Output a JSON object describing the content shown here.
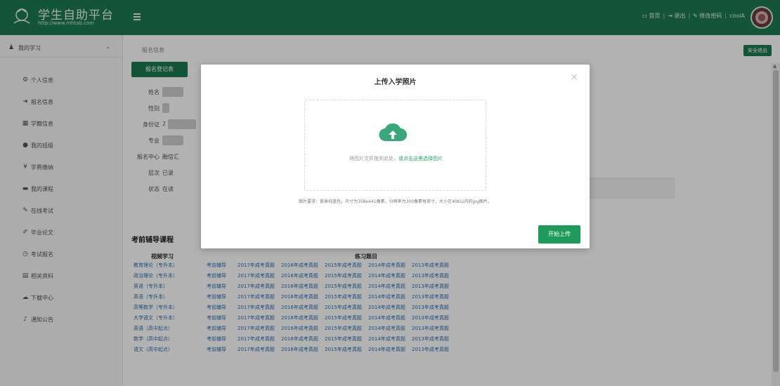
{
  "header": {
    "title": "学生自助平台",
    "subtitle": "http://www.mhtab.com",
    "links": [
      {
        "icon": "monitor-icon",
        "label": "首页"
      },
      {
        "icon": "logout-icon",
        "label": "退出"
      },
      {
        "icon": "pencil-icon",
        "label": "修改密码"
      },
      {
        "icon": "user-icon",
        "label": "coolA"
      }
    ]
  },
  "sidebar": {
    "section": "我的学习",
    "items": [
      {
        "icon": "gear-icon",
        "label": "个人信息"
      },
      {
        "icon": "arrow-icon",
        "label": "报名信息"
      },
      {
        "icon": "grid-icon",
        "label": "学籍信息"
      },
      {
        "icon": "dot-icon",
        "label": "我的班级"
      },
      {
        "icon": "book-icon",
        "label": "学费缴纳"
      },
      {
        "icon": "list-icon",
        "label": "我的课程"
      },
      {
        "icon": "pencil-icon",
        "label": "在线考试"
      },
      {
        "icon": "edit-icon",
        "label": "毕业论文"
      },
      {
        "icon": "clock-icon",
        "label": "考试报名"
      },
      {
        "icon": "table-icon",
        "label": "相关资料"
      },
      {
        "icon": "cloud-icon",
        "label": "下载中心"
      },
      {
        "icon": "bell-icon",
        "label": "通知公告"
      }
    ]
  },
  "main": {
    "breadcrumb": "报名信息",
    "logout_button": "安全退出",
    "action_button": "报名登记表",
    "info": [
      {
        "label": "姓名",
        "value": ""
      },
      {
        "label": "性别",
        "value": ""
      },
      {
        "label": "身份证",
        "value": "2"
      },
      {
        "label": "专业",
        "value": ""
      },
      {
        "label": "报名中心",
        "value": "融信汇"
      },
      {
        "label": "层次",
        "value": "已录"
      },
      {
        "label": "状态",
        "value": "在读"
      }
    ],
    "section_title": "考前辅导课程",
    "col_headers": [
      "视频学习",
      "练习题目"
    ],
    "rows": [
      [
        "教育理论（专升本）",
        "考前辅导",
        "2017年成考真题",
        "2016年成考真题",
        "2015年成考真题",
        "2014年成考真题",
        "2013年成考真题"
      ],
      [
        "政治理论（专升本）",
        "考前辅导",
        "2017年成考真题",
        "2016年成考真题",
        "2015年成考真题",
        "2014年成考真题",
        "2013年成考真题"
      ],
      [
        "英语（专升本）",
        "考前辅导",
        "2017年成考真题",
        "2016年成考真题",
        "2015年成考真题",
        "2014年成考真题",
        "2013年成考真题"
      ],
      [
        "英语（专升本）",
        "考前辅导",
        "2017年成考真题",
        "2016年成考真题",
        "2015年成考真题",
        "2014年成考真题",
        "2013年成考真题"
      ],
      [
        "高等数学（专升本）",
        "考前辅导",
        "2017年成考真题",
        "2016年成考真题",
        "2015年成考真题",
        "2014年成考真题",
        "2013年成考真题"
      ],
      [
        "大学语文（专升本）",
        "考前辅导",
        "2017年成考真题",
        "2016年成考真题",
        "2015年成考真题",
        "2014年成考真题",
        "2013年成考真题"
      ],
      [
        "英语（高中起点）",
        "考前辅导",
        "2017年成考真题",
        "2016年成考真题",
        "2015年成考真题",
        "2014年成考真题",
        "2013年成考真题"
      ],
      [
        "数学（高中起点）",
        "考前辅导",
        "2017年成考真题",
        "2016年成考真题",
        "2015年成考真题",
        "2014年成考真题",
        "2013年成考真题"
      ],
      [
        "语文（高中起点）",
        "考前辅导",
        "2017年成考真题",
        "2016年成考真题",
        "2015年成考真题",
        "2014年成考真题",
        "2013年成考真题"
      ]
    ]
  },
  "modal": {
    "title": "上传入学照片",
    "drop_text": "将图片文件拖到此处，",
    "drop_link": "或点击这里选择图片",
    "hint": "图片要求：背景纯蓝色，尺寸为358x441像素，分辨率为300像素每英寸，大小在40K以内的jpg图片。",
    "start_button": "开始上传"
  },
  "colors": {
    "brand": "#1d7a4f",
    "button": "#1f9a5a",
    "link": "#2d6fb3"
  }
}
